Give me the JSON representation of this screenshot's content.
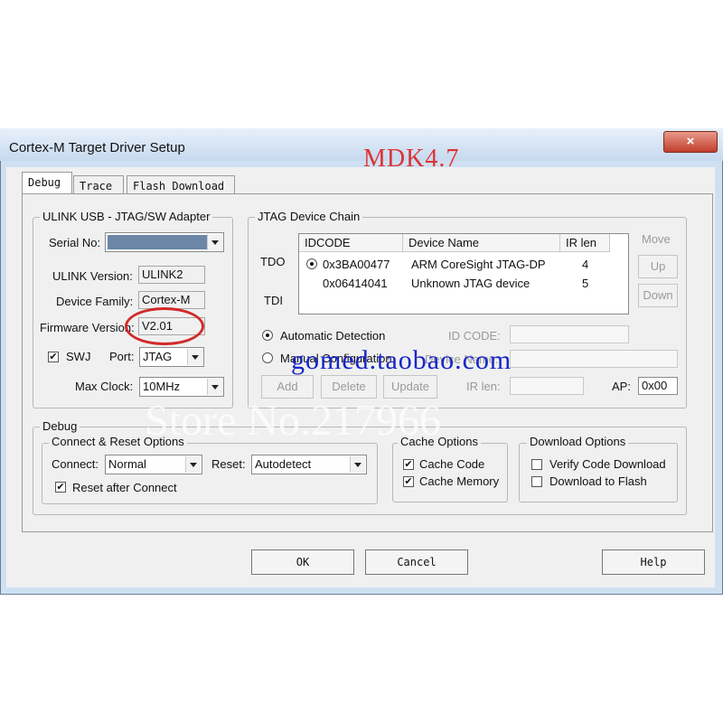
{
  "window": {
    "title": "Cortex-M Target Driver Setup",
    "close_glyph": "×"
  },
  "watermarks": {
    "mdk": "MDK4.7",
    "shop": "gomed.taobao.com",
    "store": "Store No.217966"
  },
  "tabs": [
    "Debug",
    "Trace",
    "Flash Download"
  ],
  "adapter": {
    "group_label": "ULINK USB - JTAG/SW Adapter",
    "serial_label": "Serial No:",
    "serial_value": "",
    "version_label": "ULINK Version:",
    "version_value": "ULINK2",
    "family_label": "Device Family:",
    "family_value": "Cortex-M",
    "firmware_label": "Firmware Version:",
    "firmware_value": "V2.01",
    "swj_label": "SWJ",
    "port_label": "Port:",
    "port_value": "JTAG",
    "clock_label": "Max Clock:",
    "clock_value": "10MHz"
  },
  "jtag": {
    "group_label": "JTAG Device Chain",
    "tdo": "TDO",
    "tdi": "TDI",
    "columns": [
      "IDCODE",
      "Device Name",
      "IR len"
    ],
    "rows": [
      {
        "idcode": "0x3BA00477",
        "name": "ARM CoreSight JTAG-DP",
        "irlen": "4"
      },
      {
        "idcode": "0x06414041",
        "name": "Unknown JTAG device",
        "irlen": "5"
      }
    ],
    "move_label": "Move",
    "up_label": "Up",
    "down_label": "Down",
    "auto_label": "Automatic Detection",
    "manual_label": "Manual Configuration",
    "idcode_label": "ID CODE:",
    "devname_label": "Device Name:",
    "irlen_label": "IR len:",
    "ap_label": "AP:",
    "ap_value": "0x00",
    "add_label": "Add",
    "delete_label": "Delete",
    "update_label": "Update"
  },
  "debug": {
    "group_label": "Debug",
    "connect_group": "Connect & Reset Options",
    "connect_label": "Connect:",
    "connect_value": "Normal",
    "reset_label": "Reset:",
    "reset_value": "Autodetect",
    "reset_after_label": "Reset after Connect",
    "cache_group": "Cache Options",
    "cache_code": "Cache Code",
    "cache_memory": "Cache Memory",
    "download_group": "Download Options",
    "verify_label": "Verify Code Download",
    "flash_label": "Download to Flash"
  },
  "buttons": {
    "ok": "OK",
    "cancel": "Cancel",
    "help": "Help"
  },
  "colors": {
    "annotation": "#d22a2a",
    "title_gradient_top": "#e8f1fb",
    "close": "#c33e2c"
  }
}
